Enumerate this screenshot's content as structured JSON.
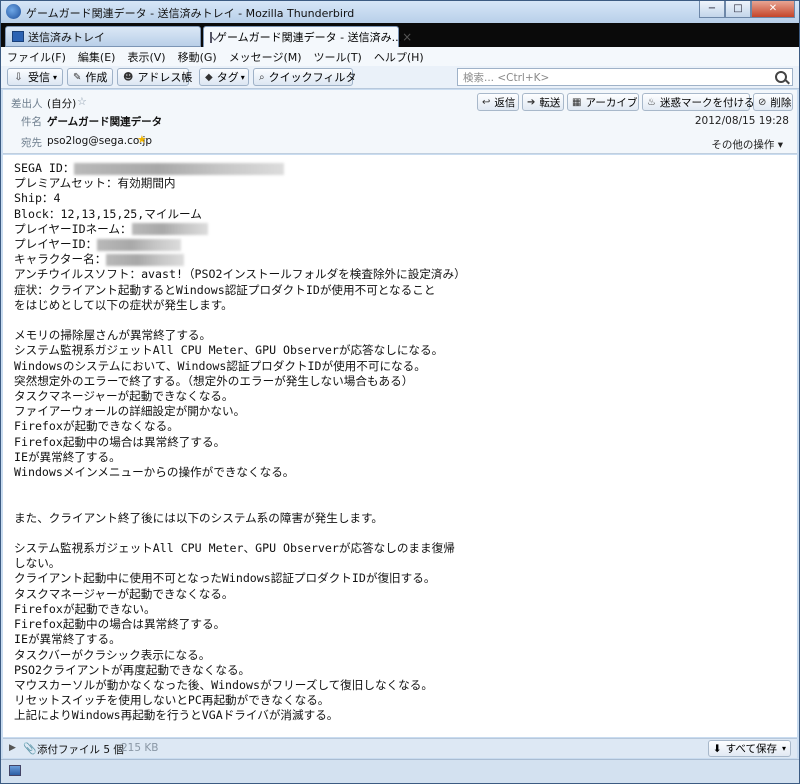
{
  "window": {
    "title": "ゲームガード関連データ - 送信済みトレイ - Mozilla Thunderbird",
    "controls": {
      "minimize": "−",
      "maximize": "□",
      "close": "✕"
    }
  },
  "tabs": [
    {
      "label": "送信済みトレイ"
    },
    {
      "label": "ゲームガード関連データ - 送信済み...",
      "close": "×"
    }
  ],
  "menu": [
    "ファイル(F)",
    "編集(E)",
    "表示(V)",
    "移動(G)",
    "メッセージ(M)",
    "ツール(T)",
    "ヘルプ(H)"
  ],
  "toolbar": {
    "receive": "受信",
    "compose": "作成",
    "addressbook": "アドレス帳",
    "tag": "タグ",
    "quickfilter": "クイックフィルタ",
    "search_placeholder": "検索... <Ctrl+K>"
  },
  "header": {
    "from_label": "差出人",
    "from_value": "(自分)",
    "subject_label": "件名",
    "subject_value": "ゲームガード関連データ",
    "to_label": "宛先",
    "to_value": "pso2log@sega.co.jp",
    "date": "2012/08/15 19:28",
    "other_actions": "その他の操作",
    "actions": {
      "reply": "返信",
      "forward": "転送",
      "archive": "アーカイブ",
      "junk": "迷惑マークを付ける",
      "delete": "削除"
    }
  },
  "body": {
    "line01": "SEGA ID：",
    "line02": "プレミアムセット：有効期間内",
    "line03": "Ship：4",
    "line04": "Block：12,13,15,25,マイルーム",
    "line05": "プレイヤーIDネーム：",
    "line06": "プレイヤーID：",
    "line07": "キャラクター名：",
    "line08": "アンチウイルスソフト：avast!（PSO2インストールフォルダを検査除外に設定済み）",
    "line09": "症状：クライアント起動するとWindows認証プロダクトIDが使用不可となること",
    "line10": "をはじめとして以下の症状が発生します。",
    "line11": "",
    "line12": "メモリの掃除屋さんが異常終了する。",
    "line13": "システム監視系ガジェットAll CPU Meter、GPU Observerが応答なしになる。",
    "line14": "Windowsのシステムにおいて、Windows認証プロダクトIDが使用不可になる。",
    "line15": "突然想定外のエラーで終了する。（想定外のエラーが発生しない場合もある）",
    "line16": "タスクマネージャーが起動できなくなる。",
    "line17": "ファイアーウォールの詳細設定が開かない。",
    "line18": "Firefoxが起動できなくなる。",
    "line19": "Firefox起動中の場合は異常終了する。",
    "line20": "IEが異常終了する。",
    "line21": "Windowsメインメニューからの操作ができなくなる。",
    "line22": "",
    "line23": "",
    "line24": "また、クライアント終了後には以下のシステム系の障害が発生します。",
    "line25": "",
    "line26": "システム監視系ガジェットAll CPU Meter、GPU Observerが応答なしのまま復帰",
    "line27": "しない。",
    "line28": "クライアント起動中に使用不可となったWindows認証プロダクトIDが復旧する。",
    "line29": "タスクマネージャーが起動できなくなる。",
    "line30": "Firefoxが起動できない。",
    "line31": "Firefox起動中の場合は異常終了する。",
    "line32": "IEが異常終了する。",
    "line33": "タスクバーがクラシック表示になる。",
    "line34": "PSO2クライアントが再度起動できなくなる。",
    "line35": "マウスカーソルが動かなくなった後、Windowsがフリーズして復旧しなくなる。",
    "line36": "リセットスイッチを使用しないとPC再起動ができなくなる。",
    "line37": "上記によりWindows再起動を行うとVGAドライバが消滅する。"
  },
  "attachments": {
    "label": "添付ファイル 5 個",
    "size": "215 KB",
    "save_all": "すべて保存"
  },
  "icons": [
    "app-icon",
    "folder-icon",
    "mail-icon",
    "download-icon",
    "pencil-icon",
    "contacts-icon",
    "tag-icon",
    "filter-icon",
    "search-icon",
    "reply-icon",
    "forward-icon",
    "archive-icon",
    "flame-icon",
    "delete-icon",
    "star-icon",
    "paperclip-icon",
    "save-icon",
    "status-icon"
  ]
}
